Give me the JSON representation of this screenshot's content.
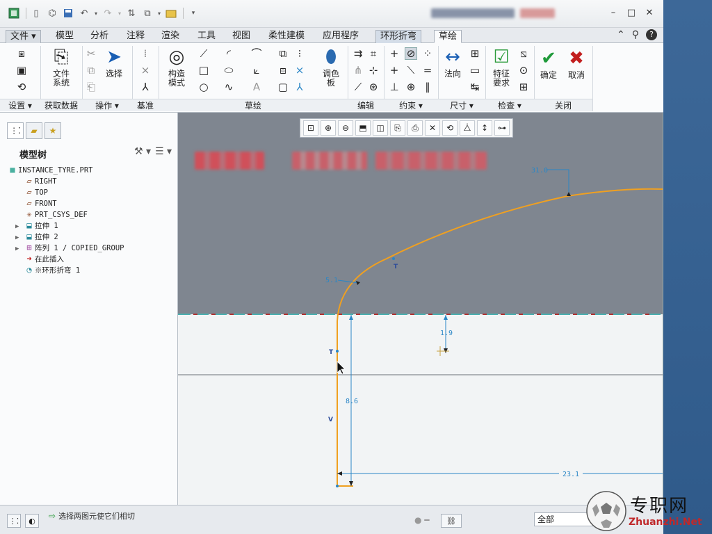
{
  "window": {
    "quick_access_icons": [
      "app-icon",
      "new-icon",
      "open-icon",
      "save-icon",
      "undo-icon",
      "redo-icon",
      "regen-icon",
      "windows-icon",
      "close-window-icon"
    ],
    "controls": {
      "minimize": "–",
      "maximize": "□",
      "close": "✕"
    }
  },
  "menu_tabs": [
    {
      "label": "文件 ▾"
    },
    {
      "label": "模型"
    },
    {
      "label": "分析"
    },
    {
      "label": "注释"
    },
    {
      "label": "渲染"
    },
    {
      "label": "工具"
    },
    {
      "label": "视图"
    },
    {
      "label": "柔性建模"
    },
    {
      "label": "应用程序"
    },
    {
      "label": "环形折弯"
    },
    {
      "label": "草绘"
    }
  ],
  "ribbon": {
    "groups": [
      {
        "label": "设置 ▾"
      },
      {
        "label": "获取数据"
      },
      {
        "label": "操作 ▾"
      },
      {
        "label": "基准"
      },
      {
        "label": "草绘"
      },
      {
        "label": "编辑"
      },
      {
        "label": "约束 ▾"
      },
      {
        "label": "尺寸 ▾"
      },
      {
        "label": "检查 ▾"
      },
      {
        "label": "关闭"
      }
    ],
    "big_buttons": {
      "file_system": "文件\n系统",
      "select": "选择",
      "construction_mode": "构造\n模式",
      "palette": "调色\n板",
      "normal": "法向",
      "feature_requirements": "特征\n要求",
      "ok": "确定",
      "cancel": "取消"
    }
  },
  "model_tree": {
    "title": "模型树",
    "items": [
      {
        "label": "INSTANCE_TYRE.PRT",
        "icon": "part-icon",
        "expandable": false,
        "indent": 0
      },
      {
        "label": "RIGHT",
        "icon": "datum-plane-icon",
        "expandable": false,
        "indent": 1
      },
      {
        "label": "TOP",
        "icon": "datum-plane-icon",
        "expandable": false,
        "indent": 1
      },
      {
        "label": "FRONT",
        "icon": "datum-plane-icon",
        "expandable": false,
        "indent": 1
      },
      {
        "label": "PRT_CSYS_DEF",
        "icon": "csys-icon",
        "expandable": false,
        "indent": 1
      },
      {
        "label": "拉伸 1",
        "icon": "extrude-icon",
        "expandable": true,
        "indent": 1
      },
      {
        "label": "拉伸 2",
        "icon": "extrude-icon",
        "expandable": true,
        "indent": 1
      },
      {
        "label": "阵列 1 / COPIED_GROUP",
        "icon": "pattern-icon",
        "expandable": true,
        "indent": 1
      },
      {
        "label": "在此插入",
        "icon": "insert-here-icon",
        "expandable": false,
        "indent": 1
      },
      {
        "label": "※环形折弯 1",
        "icon": "toroidal-bend-icon",
        "expandable": false,
        "indent": 1
      }
    ]
  },
  "sketch": {
    "dimensions": {
      "d1": "31.0",
      "d2": "5.1",
      "d3": "1.9",
      "d4": "8.6",
      "d5": "23.1"
    },
    "constraint_labels": {
      "t1": "T",
      "t2": "T",
      "v": "V"
    },
    "colors": {
      "curve": "#f0a020",
      "dimension": "#2a86c6",
      "plane_bg": "#7f8690",
      "dash_red": "#b03030",
      "dash_cyan": "#4ab0b0"
    }
  },
  "view_toolbar": [
    "refit-icon",
    "zoom-in-icon",
    "zoom-out-icon",
    "repaint-icon",
    "display-style-icon",
    "saved-views-icon",
    "sketch-view-icon",
    "datum-display-icon",
    "annotation-display-icon",
    "spin-center-icon",
    "sketcher-display-icon",
    "sketch-orient-icon"
  ],
  "status": {
    "message": "选择两图元使它们相切",
    "filter_value": "全部"
  },
  "watermark": {
    "line1": "专职网",
    "line2": "Zhuanzhi.Net"
  }
}
